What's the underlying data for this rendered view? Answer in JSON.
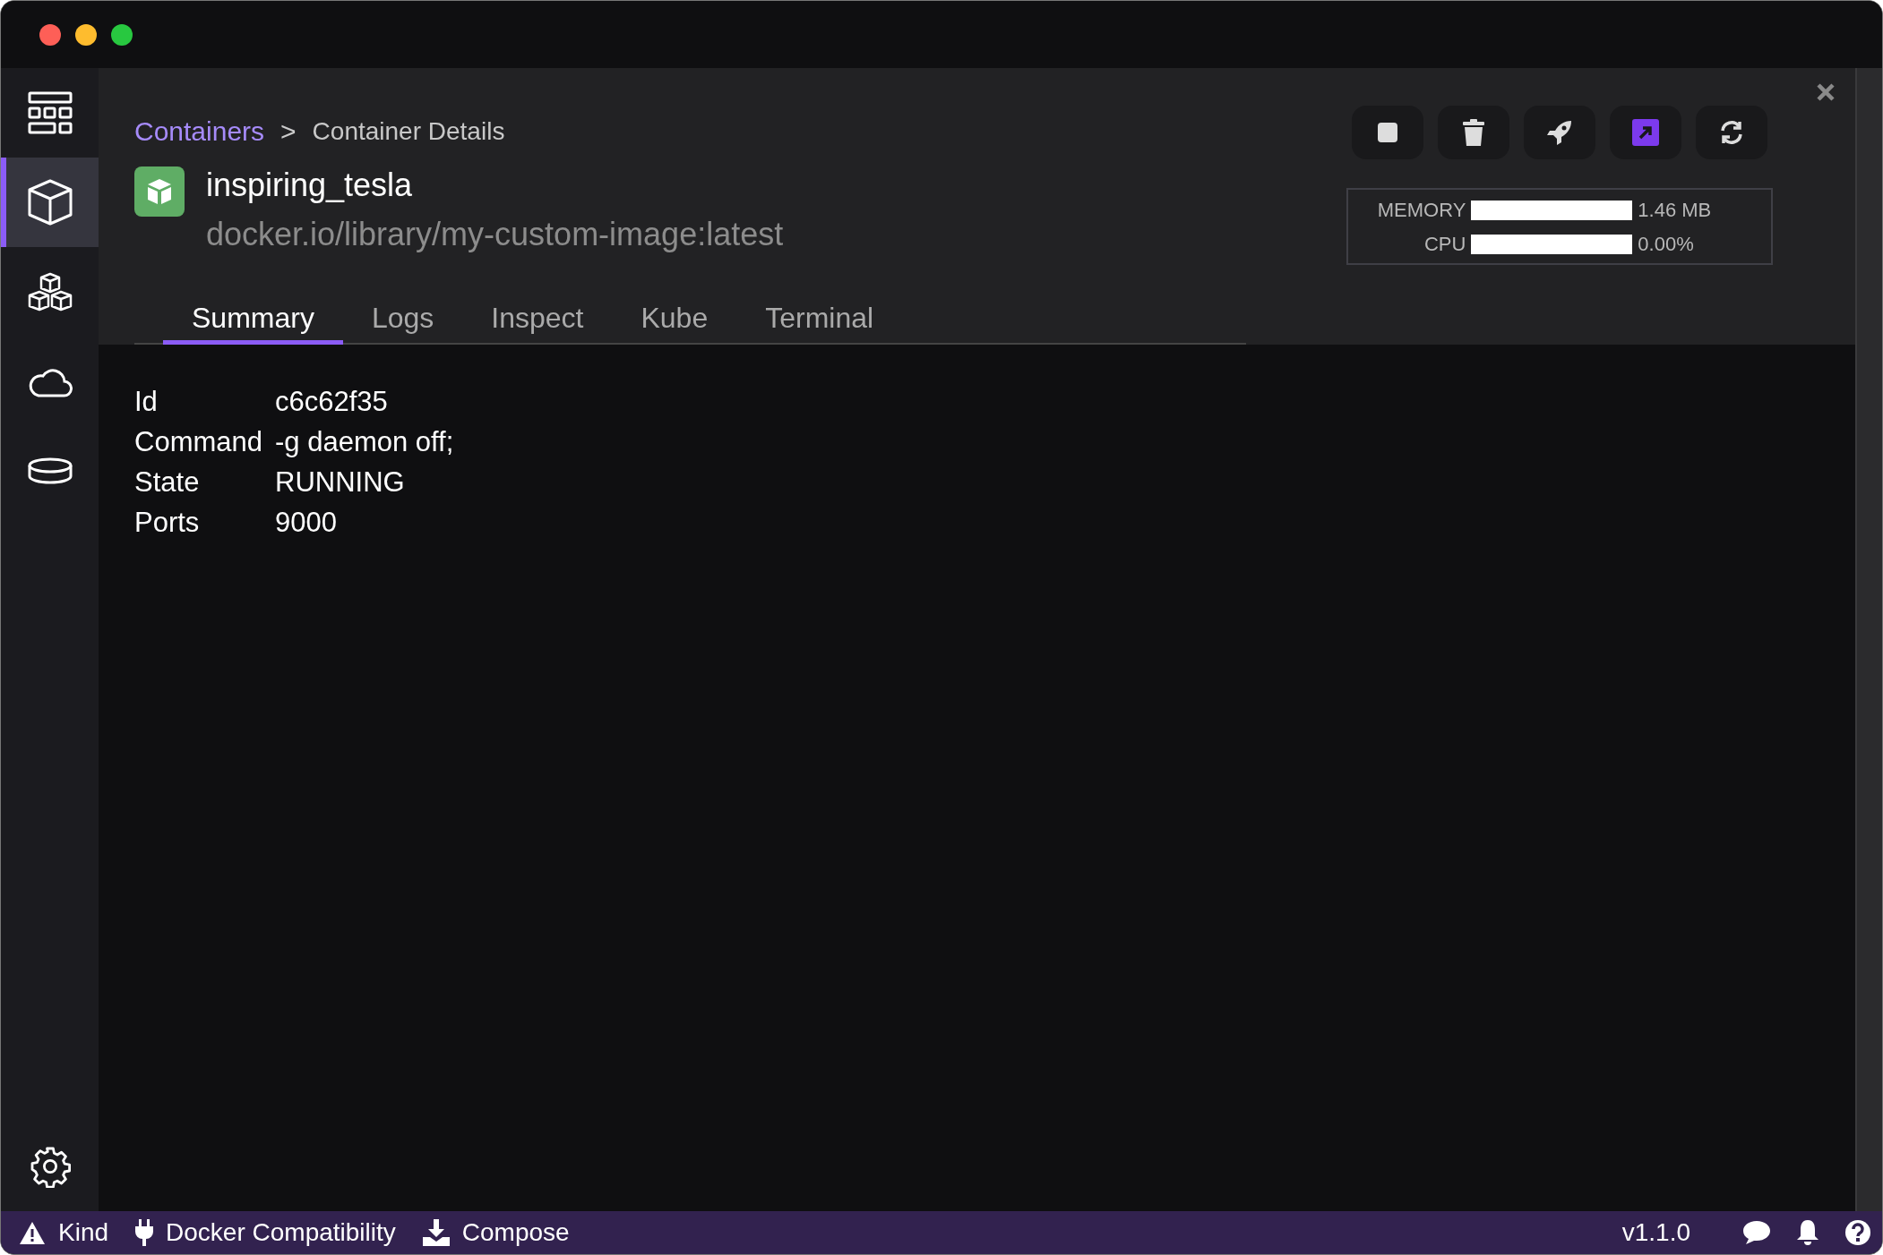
{
  "sidebar": {
    "items": [
      {
        "selected": false
      },
      {
        "selected": true
      },
      {
        "selected": false
      },
      {
        "selected": false
      },
      {
        "selected": false
      }
    ]
  },
  "breadcrumb": {
    "parent": "Containers",
    "separator": ">",
    "current": "Container Details"
  },
  "container": {
    "name": "inspiring_tesla",
    "image": "docker.io/library/my-custom-image:latest"
  },
  "stats": [
    {
      "label": "MEMORY",
      "level": 1,
      "reading": "1.46 MB"
    },
    {
      "label": "CPU",
      "level": 1,
      "reading": "0.00%"
    }
  ],
  "tabs": [
    {
      "label": "Summary",
      "selected": true
    },
    {
      "label": "Logs",
      "selected": false
    },
    {
      "label": "Inspect",
      "selected": false
    },
    {
      "label": "Kube",
      "selected": false
    },
    {
      "label": "Terminal",
      "selected": false
    }
  ],
  "details": [
    {
      "label": "Id",
      "value": "c6c62f35"
    },
    {
      "label": "Command",
      "value": "-g daemon off;"
    },
    {
      "label": "State",
      "value": "RUNNING"
    },
    {
      "label": "Ports",
      "value": "9000"
    }
  ],
  "status_bar": {
    "left": [
      {
        "label": "Kind"
      },
      {
        "label": "Docker Compatibility"
      },
      {
        "label": "Compose"
      }
    ],
    "version": "v1.1.0"
  }
}
